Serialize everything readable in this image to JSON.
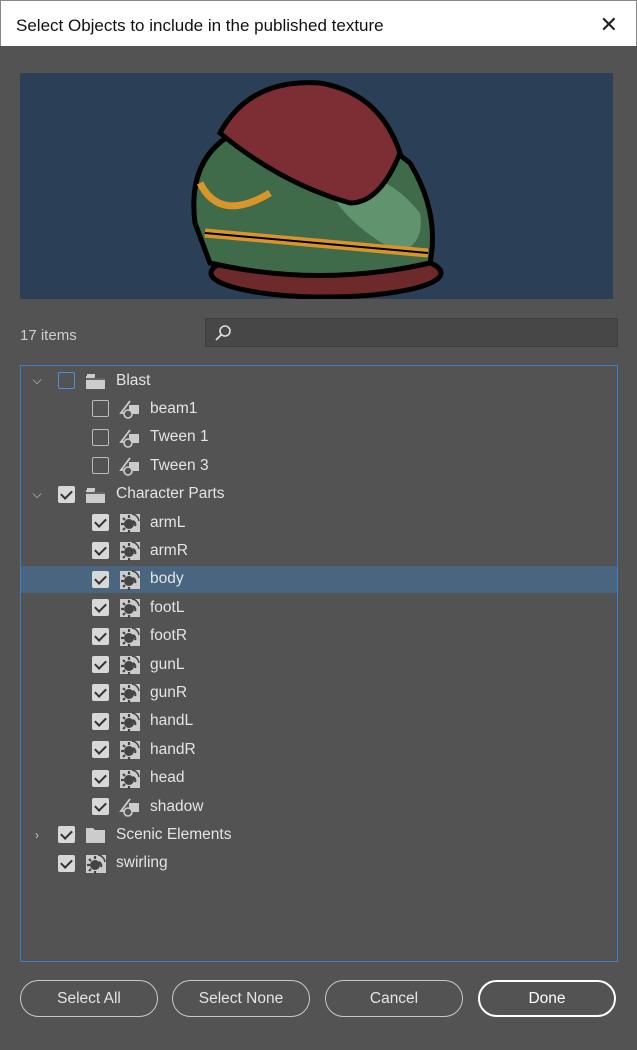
{
  "title": "Select Objects to include in the published texture",
  "item_count": "17 items",
  "search": {
    "placeholder": ""
  },
  "tree": [
    {
      "label": "Blast",
      "type": "folder",
      "level": 0,
      "expanded": true,
      "checked": false,
      "focused": true
    },
    {
      "label": "beam1",
      "type": "shape",
      "level": 1,
      "checked": false
    },
    {
      "label": "Tween 1",
      "type": "shape",
      "level": 1,
      "checked": false
    },
    {
      "label": "Tween 3",
      "type": "shape",
      "level": 1,
      "checked": false
    },
    {
      "label": "Character Parts",
      "type": "folder",
      "level": 0,
      "expanded": true,
      "checked": true
    },
    {
      "label": "armL",
      "type": "symbol",
      "level": 1,
      "checked": true
    },
    {
      "label": "armR",
      "type": "symbol",
      "level": 1,
      "checked": true
    },
    {
      "label": "body",
      "type": "symbol",
      "level": 1,
      "checked": true,
      "selected": true
    },
    {
      "label": "footL",
      "type": "symbol",
      "level": 1,
      "checked": true
    },
    {
      "label": "footR",
      "type": "symbol",
      "level": 1,
      "checked": true
    },
    {
      "label": "gunL",
      "type": "symbol",
      "level": 1,
      "checked": true
    },
    {
      "label": "gunR",
      "type": "symbol",
      "level": 1,
      "checked": true
    },
    {
      "label": "handL",
      "type": "symbol",
      "level": 1,
      "checked": true
    },
    {
      "label": "handR",
      "type": "symbol",
      "level": 1,
      "checked": true
    },
    {
      "label": "head",
      "type": "symbol",
      "level": 1,
      "checked": true
    },
    {
      "label": "shadow",
      "type": "shape",
      "level": 1,
      "checked": true
    },
    {
      "label": "Scenic Elements",
      "type": "folder-closed",
      "level": 0,
      "expanded": false,
      "checked": true
    },
    {
      "label": "swirling",
      "type": "symbol",
      "level": 0,
      "checked": true
    }
  ],
  "buttons": {
    "select_all": "Select All",
    "select_none": "Select None",
    "cancel": "Cancel",
    "done": "Done"
  },
  "colors": {
    "accent": "#3d7fc4",
    "selection": "#4a6580",
    "preview_bg": "#2b3f57"
  }
}
